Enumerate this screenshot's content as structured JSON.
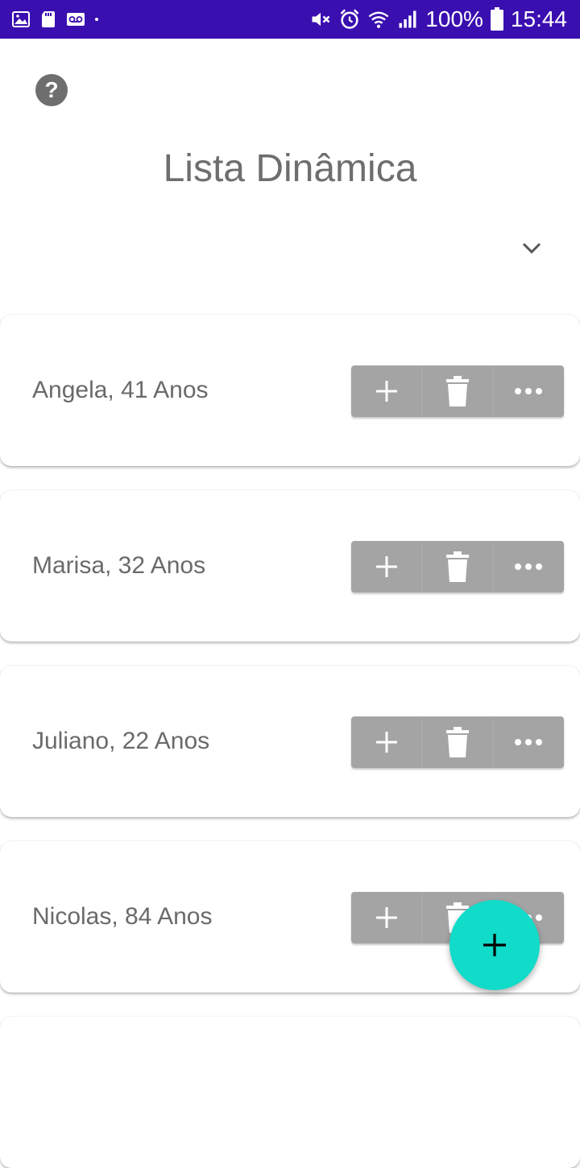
{
  "status_bar": {
    "battery_percent": "100%",
    "time": "15:44",
    "background_color": "#3a0fb0",
    "icons_left": [
      "image-icon",
      "sd-card-icon",
      "voicemail-icon",
      "dot-icon"
    ],
    "icons_right": [
      "mute-icon",
      "alarm-icon",
      "wifi-icon",
      "signal-icon",
      "battery-icon"
    ]
  },
  "header": {
    "help_icon": "help-circle-icon",
    "title": "Lista Dinâmica",
    "expand_icon": "chevron-down-icon"
  },
  "list": {
    "items": [
      {
        "label": "Angela, 41 Anos"
      },
      {
        "label": "Marisa, 32 Anos"
      },
      {
        "label": "Juliano, 22 Anos"
      },
      {
        "label": "Nicolas, 84 Anos"
      }
    ],
    "actions": [
      "plus-icon",
      "trash-icon",
      "more-horizontal-icon"
    ],
    "action_bar_color": "#a4a4a4"
  },
  "fab": {
    "icon": "plus-icon",
    "color": "#11dbc9"
  }
}
